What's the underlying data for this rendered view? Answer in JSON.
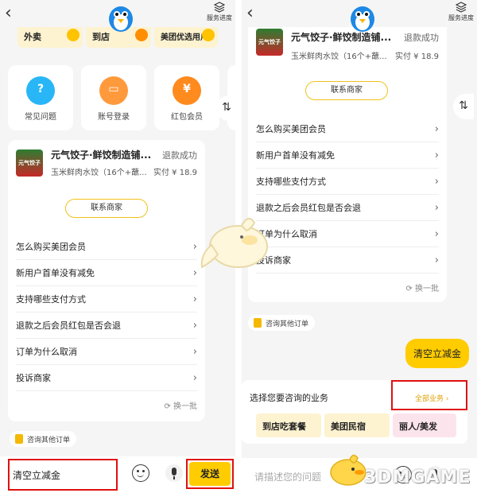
{
  "left": {
    "header": {
      "service_progress": "服务进度"
    },
    "promos": [
      "外卖",
      "到店",
      "美团优选用户"
    ],
    "services": [
      {
        "label": "常见问题",
        "color": "#29b6f6",
        "glyph": "?"
      },
      {
        "label": "账号登录",
        "color": "#ff9a3c",
        "glyph": "▭"
      },
      {
        "label": "红包会员",
        "color": "#ff8a1e",
        "glyph": "¥"
      }
    ],
    "order": {
      "thumb_text": "元气饺子",
      "shop": "元气饺子·鲜饺制造铺...",
      "status": "退款成功",
      "item": "玉米鲜肉水饺（16个+蘸...",
      "paid": "实付 ¥ 18.9",
      "contact": "联系商家"
    },
    "questions": [
      "怎么购买美团会员",
      "新用户首单没有减免",
      "支持哪些支付方式",
      "退款之后会员红包是否会退",
      "订单为什么取消",
      "投诉商家"
    ],
    "refresh": "换一批",
    "other_orders": "咨询其他订单",
    "input_value": "清空立减金",
    "send": "发送"
  },
  "right": {
    "header": {
      "service_progress": "服务进度"
    },
    "order": {
      "thumb_text": "元气饺子",
      "shop": "元气饺子·鲜饺制造铺...",
      "status": "退款成功",
      "item": "玉米鲜肉水饺（16个+蘸...",
      "paid": "实付 ¥ 18.9",
      "contact": "联系商家"
    },
    "questions": [
      "怎么购买美团会员",
      "新用户首单没有减免",
      "支持哪些支付方式",
      "退款之后会员红包是否会退",
      "订单为什么取消",
      "投诉商家"
    ],
    "refresh": "换一批",
    "other_orders": "咨询其他订单",
    "user_message": "清空立减金",
    "business": {
      "title": "选择您要咨询的业务",
      "all": "全部业务 ›",
      "chips": [
        "到店吃套餐",
        "美团民宿",
        "丽人/美发"
      ]
    },
    "input_placeholder": "请描述您的问题"
  },
  "watermark": "3DMGAME",
  "colors": {
    "accent": "#ffcc00",
    "highlight": "#e01010"
  }
}
